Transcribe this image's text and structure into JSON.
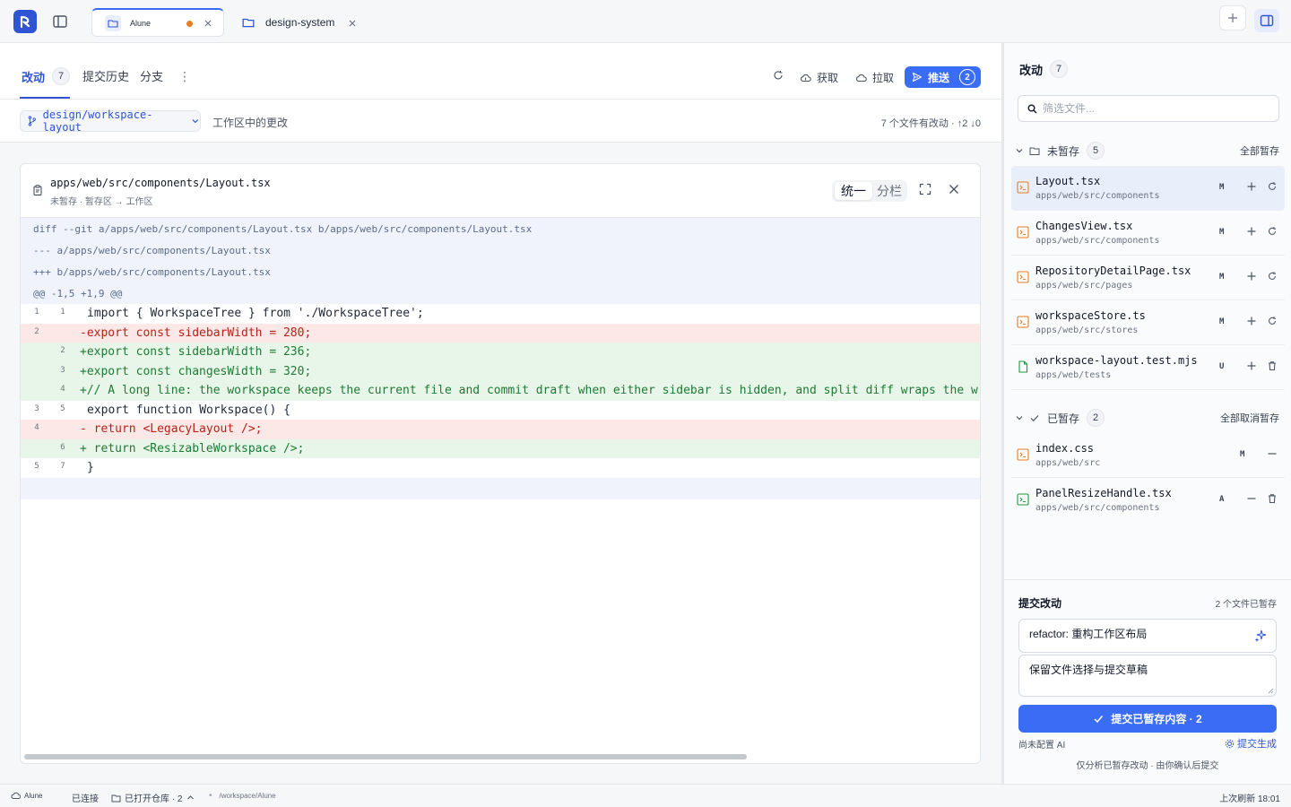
{
  "tabs": [
    {
      "label": "Alune",
      "modified": true
    },
    {
      "label": "design-system"
    }
  ],
  "nav": {
    "tabs": [
      {
        "label": "改动",
        "count": "7"
      },
      {
        "label": "提交历史"
      },
      {
        "label": "分支"
      }
    ],
    "actions": {
      "fetch": "获取",
      "pull": "拉取",
      "push": "推送",
      "push_count": "2"
    }
  },
  "subbar": {
    "branch": "design/workspace-layout",
    "worktree": "工作区中的更改",
    "summary": "7 个文件有改动 · ↑2 ↓0"
  },
  "diff": {
    "path": "apps/web/src/components/Layout.tsx",
    "state": "未暂存 · 暂存区 → 工作区",
    "view_unified": "统一",
    "view_split": "分栏",
    "meta": [
      "diff --git a/apps/web/src/components/Layout.tsx b/apps/web/src/components/Layout.tsx",
      "--- a/apps/web/src/components/Layout.tsx",
      "+++ b/apps/web/src/components/Layout.tsx",
      "@@ -1,5 +1,9 @@"
    ],
    "lines": [
      {
        "type": "ctx",
        "old": "1",
        "new": "1",
        "text": "import { WorkspaceTree } from './WorkspaceTree';"
      },
      {
        "type": "del",
        "old": "2",
        "new": "",
        "text": "-export const sidebarWidth = 280;"
      },
      {
        "type": "add",
        "old": "",
        "new": "2",
        "text": "+export const sidebarWidth = 236;"
      },
      {
        "type": "add",
        "old": "",
        "new": "3",
        "text": "+export const changesWidth = 320;"
      },
      {
        "type": "add",
        "old": "",
        "new": "4",
        "text": "+// A long line: the workspace keeps the current file and commit draft when either sidebar is hidden, and split diff wraps the w"
      },
      {
        "type": "ctx",
        "old": "3",
        "new": "5",
        "text": "export function Workspace() {"
      },
      {
        "type": "del",
        "old": "4",
        "new": "",
        "text": "-  return <LegacyLayout />;"
      },
      {
        "type": "add",
        "old": "",
        "new": "6",
        "text": "+  return <ResizableWorkspace />;"
      },
      {
        "type": "ctx",
        "old": "5",
        "new": "7",
        "text": "}"
      }
    ]
  },
  "panel": {
    "title": "改动",
    "count": "7",
    "filter_placeholder": "筛选文件...",
    "unstaged": {
      "label": "未暂存",
      "count": "5",
      "action": "全部暂存",
      "files": [
        {
          "name": "Layout.tsx",
          "dir": "apps/web/src/components",
          "status": "M"
        },
        {
          "name": "ChangesView.tsx",
          "dir": "apps/web/src/components",
          "status": "M"
        },
        {
          "name": "RepositoryDetailPage.tsx",
          "dir": "apps/web/src/pages",
          "status": "M"
        },
        {
          "name": "workspaceStore.ts",
          "dir": "apps/web/src/stores",
          "status": "M"
        },
        {
          "name": "workspace-layout.test.mjs",
          "dir": "apps/web/tests",
          "status": "U"
        }
      ]
    },
    "staged": {
      "label": "已暂存",
      "count": "2",
      "action": "全部取消暂存",
      "files": [
        {
          "name": "index.css",
          "dir": "apps/web/src",
          "status": "M"
        },
        {
          "name": "PanelResizeHandle.tsx",
          "dir": "apps/web/src/components",
          "status": "A"
        }
      ]
    }
  },
  "commit": {
    "title": "提交改动",
    "staged_info": "2 个文件已暂存",
    "message": "refactor: 重构工作区布局",
    "description": "保留文件选择与提交草稿",
    "button": "提交已暂存内容 · 2",
    "no_ai": "尚未配置 AI",
    "generate": "提交生成",
    "footer": "仅分析已暂存改动 · 由你确认后提交"
  },
  "status": {
    "app": "Alune",
    "connection": "已连接",
    "repos": "已打开仓库 · 2",
    "path": "/workspace/Alune",
    "refresh": "上次刷新 18:01"
  },
  "colors": {
    "accent": "#3b6cf6",
    "deleted": "#b42318",
    "added": "#1e7a34",
    "modified_dot": "#e67e22"
  }
}
